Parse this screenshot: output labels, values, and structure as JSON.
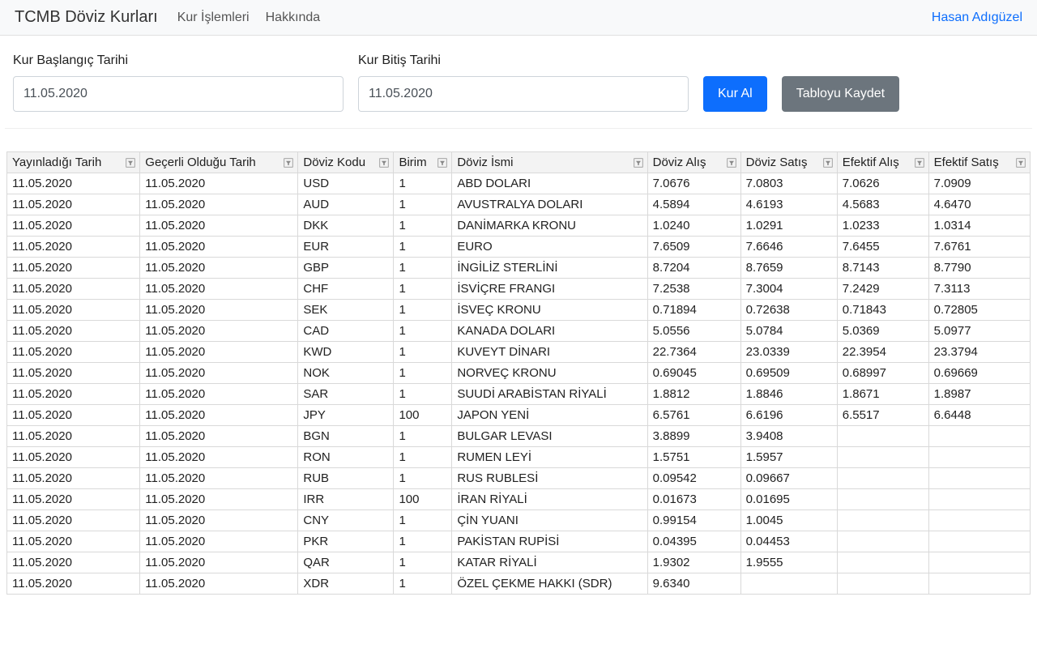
{
  "nav": {
    "brand": "TCMB Döviz Kurları",
    "link_operations": "Kur İşlemleri",
    "link_about": "Hakkında",
    "user": "Hasan Adıgüzel"
  },
  "filters": {
    "start_label": "Kur Başlangıç Tarihi",
    "start_value": "11.05.2020",
    "end_label": "Kur Bitiş Tarihi",
    "end_value": "11.05.2020",
    "btn_fetch": "Kur Al",
    "btn_save": "Tabloyu Kaydet"
  },
  "columns": [
    "Yayınladığı Tarih",
    "Geçerli Olduğu Tarih",
    "Döviz Kodu",
    "Birim",
    "Döviz İsmi",
    "Döviz Alış",
    "Döviz Satış",
    "Efektif Alış",
    "Efektif Satış"
  ],
  "rows": [
    {
      "pub": "11.05.2020",
      "valid": "11.05.2020",
      "code": "USD",
      "unit": "1",
      "name": "ABD DOLARI",
      "fb": "7.0676",
      "fs": "7.0803",
      "eb": "7.0626",
      "es": "7.0909"
    },
    {
      "pub": "11.05.2020",
      "valid": "11.05.2020",
      "code": "AUD",
      "unit": "1",
      "name": "AVUSTRALYA DOLARI",
      "fb": "4.5894",
      "fs": "4.6193",
      "eb": "4.5683",
      "es": "4.6470"
    },
    {
      "pub": "11.05.2020",
      "valid": "11.05.2020",
      "code": "DKK",
      "unit": "1",
      "name": "DANİMARKA KRONU",
      "fb": "1.0240",
      "fs": "1.0291",
      "eb": "1.0233",
      "es": "1.0314"
    },
    {
      "pub": "11.05.2020",
      "valid": "11.05.2020",
      "code": "EUR",
      "unit": "1",
      "name": "EURO",
      "fb": "7.6509",
      "fs": "7.6646",
      "eb": "7.6455",
      "es": "7.6761"
    },
    {
      "pub": "11.05.2020",
      "valid": "11.05.2020",
      "code": "GBP",
      "unit": "1",
      "name": "İNGİLİZ STERLİNİ",
      "fb": "8.7204",
      "fs": "8.7659",
      "eb": "8.7143",
      "es": "8.7790"
    },
    {
      "pub": "11.05.2020",
      "valid": "11.05.2020",
      "code": "CHF",
      "unit": "1",
      "name": "İSVİÇRE FRANGI",
      "fb": "7.2538",
      "fs": "7.3004",
      "eb": "7.2429",
      "es": "7.3113"
    },
    {
      "pub": "11.05.2020",
      "valid": "11.05.2020",
      "code": "SEK",
      "unit": "1",
      "name": "İSVEÇ KRONU",
      "fb": "0.71894",
      "fs": "0.72638",
      "eb": "0.71843",
      "es": "0.72805"
    },
    {
      "pub": "11.05.2020",
      "valid": "11.05.2020",
      "code": "CAD",
      "unit": "1",
      "name": "KANADA DOLARI",
      "fb": "5.0556",
      "fs": "5.0784",
      "eb": "5.0369",
      "es": "5.0977"
    },
    {
      "pub": "11.05.2020",
      "valid": "11.05.2020",
      "code": "KWD",
      "unit": "1",
      "name": "KUVEYT DİNARI",
      "fb": "22.7364",
      "fs": "23.0339",
      "eb": "22.3954",
      "es": "23.3794"
    },
    {
      "pub": "11.05.2020",
      "valid": "11.05.2020",
      "code": "NOK",
      "unit": "1",
      "name": "NORVEÇ KRONU",
      "fb": "0.69045",
      "fs": "0.69509",
      "eb": "0.68997",
      "es": "0.69669"
    },
    {
      "pub": "11.05.2020",
      "valid": "11.05.2020",
      "code": "SAR",
      "unit": "1",
      "name": "SUUDİ ARABİSTAN RİYALİ",
      "fb": "1.8812",
      "fs": "1.8846",
      "eb": "1.8671",
      "es": "1.8987"
    },
    {
      "pub": "11.05.2020",
      "valid": "11.05.2020",
      "code": "JPY",
      "unit": "100",
      "name": "JAPON YENİ",
      "fb": "6.5761",
      "fs": "6.6196",
      "eb": "6.5517",
      "es": "6.6448"
    },
    {
      "pub": "11.05.2020",
      "valid": "11.05.2020",
      "code": "BGN",
      "unit": "1",
      "name": "BULGAR LEVASI",
      "fb": "3.8899",
      "fs": "3.9408",
      "eb": "",
      "es": ""
    },
    {
      "pub": "11.05.2020",
      "valid": "11.05.2020",
      "code": "RON",
      "unit": "1",
      "name": "RUMEN LEYİ",
      "fb": "1.5751",
      "fs": "1.5957",
      "eb": "",
      "es": ""
    },
    {
      "pub": "11.05.2020",
      "valid": "11.05.2020",
      "code": "RUB",
      "unit": "1",
      "name": "RUS RUBLESİ",
      "fb": "0.09542",
      "fs": "0.09667",
      "eb": "",
      "es": ""
    },
    {
      "pub": "11.05.2020",
      "valid": "11.05.2020",
      "code": "IRR",
      "unit": "100",
      "name": "İRAN RİYALİ",
      "fb": "0.01673",
      "fs": "0.01695",
      "eb": "",
      "es": ""
    },
    {
      "pub": "11.05.2020",
      "valid": "11.05.2020",
      "code": "CNY",
      "unit": "1",
      "name": "ÇİN YUANI",
      "fb": "0.99154",
      "fs": "1.0045",
      "eb": "",
      "es": ""
    },
    {
      "pub": "11.05.2020",
      "valid": "11.05.2020",
      "code": "PKR",
      "unit": "1",
      "name": "PAKİSTAN RUPİSİ",
      "fb": "0.04395",
      "fs": "0.04453",
      "eb": "",
      "es": ""
    },
    {
      "pub": "11.05.2020",
      "valid": "11.05.2020",
      "code": "QAR",
      "unit": "1",
      "name": "KATAR RİYALİ",
      "fb": "1.9302",
      "fs": "1.9555",
      "eb": "",
      "es": ""
    },
    {
      "pub": "11.05.2020",
      "valid": "11.05.2020",
      "code": "XDR",
      "unit": "1",
      "name": "ÖZEL ÇEKME HAKKI (SDR)",
      "fb": "9.6340",
      "fs": "",
      "eb": "",
      "es": ""
    }
  ]
}
